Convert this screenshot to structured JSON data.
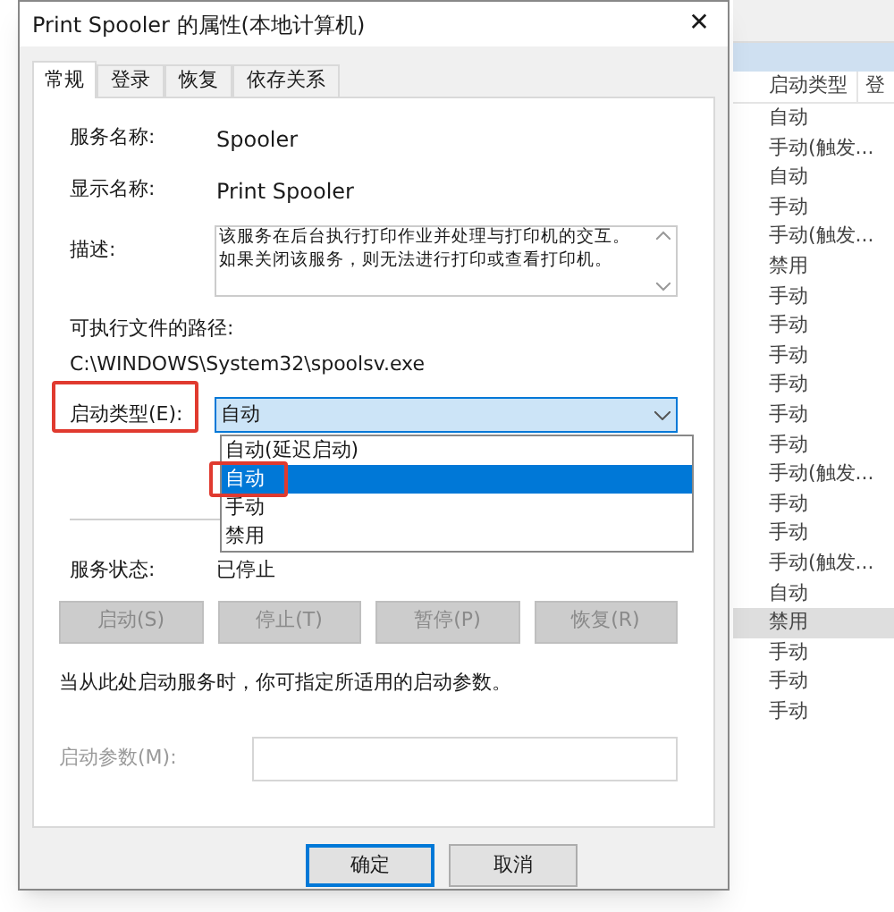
{
  "window": {
    "title": "Print Spooler 的属性(本地计算机)",
    "close": "✕"
  },
  "tabs": [
    {
      "label": "常规",
      "selected": true
    },
    {
      "label": "登录",
      "selected": false
    },
    {
      "label": "恢复",
      "selected": false
    },
    {
      "label": "依存关系",
      "selected": false
    }
  ],
  "info": [
    {
      "label": "服务名称:",
      "value": "Spooler"
    },
    {
      "label": "显示名称:",
      "value": "Print Spooler"
    }
  ],
  "description": {
    "label": "描述:",
    "value": "该服务在后台执行打印作业并处理与打印机的交互。如果关闭该服务，则无法进行打印或查看打印机。"
  },
  "path": {
    "label": "可执行文件的路径:",
    "value": "C:\\WINDOWS\\System32\\spoolsv.exe"
  },
  "startup_type": {
    "label": "启动类型(E):",
    "highlighted": true,
    "value": "自动",
    "expanded": true,
    "options": [
      {
        "label": "自动(延迟启动)",
        "selected": false,
        "highlighted": false
      },
      {
        "label": "自动",
        "selected": true,
        "highlighted": true
      },
      {
        "label": "手动",
        "selected": false,
        "highlighted": false
      },
      {
        "label": "禁用",
        "selected": false,
        "highlighted": false
      }
    ]
  },
  "service_status": {
    "label": "服务状态:",
    "value": "已停止"
  },
  "service_buttons": [
    {
      "label": "启动(S)",
      "disabled": true
    },
    {
      "label": "停止(T)",
      "disabled": true
    },
    {
      "label": "暂停(P)",
      "disabled": true
    },
    {
      "label": "恢复(R)",
      "disabled": true
    }
  ],
  "note": "当从此处启动服务时，你可指定所适用的启动参数。",
  "start_params": {
    "label": "启动参数(M):",
    "disabled": true
  },
  "dialog_buttons": [
    {
      "label": "确定",
      "default": true
    },
    {
      "label": "取消",
      "default": false
    }
  ],
  "background_list": {
    "columns": [
      "启动类型",
      "登"
    ],
    "rows": [
      {
        "startup": "自动",
        "selected": false
      },
      {
        "startup": "手动(触发...",
        "selected": false
      },
      {
        "startup": "自动",
        "selected": false
      },
      {
        "startup": "手动",
        "selected": false
      },
      {
        "startup": "手动(触发...",
        "selected": false
      },
      {
        "startup": "禁用",
        "selected": false
      },
      {
        "startup": "手动",
        "selected": false
      },
      {
        "startup": "手动",
        "selected": false
      },
      {
        "startup": "手动",
        "selected": false
      },
      {
        "startup": "手动",
        "selected": false
      },
      {
        "startup": "手动",
        "selected": false
      },
      {
        "startup": "手动",
        "selected": false
      },
      {
        "startup": "手动(触发...",
        "selected": false
      },
      {
        "startup": "手动",
        "selected": false
      },
      {
        "startup": "手动",
        "selected": false
      },
      {
        "startup": "手动(触发...",
        "selected": false
      },
      {
        "startup": "自动",
        "selected": false
      },
      {
        "startup": "禁用",
        "selected": true
      },
      {
        "startup": "手动",
        "selected": false
      },
      {
        "startup": "手动",
        "selected": false
      },
      {
        "startup": "手动",
        "selected": false
      }
    ]
  }
}
